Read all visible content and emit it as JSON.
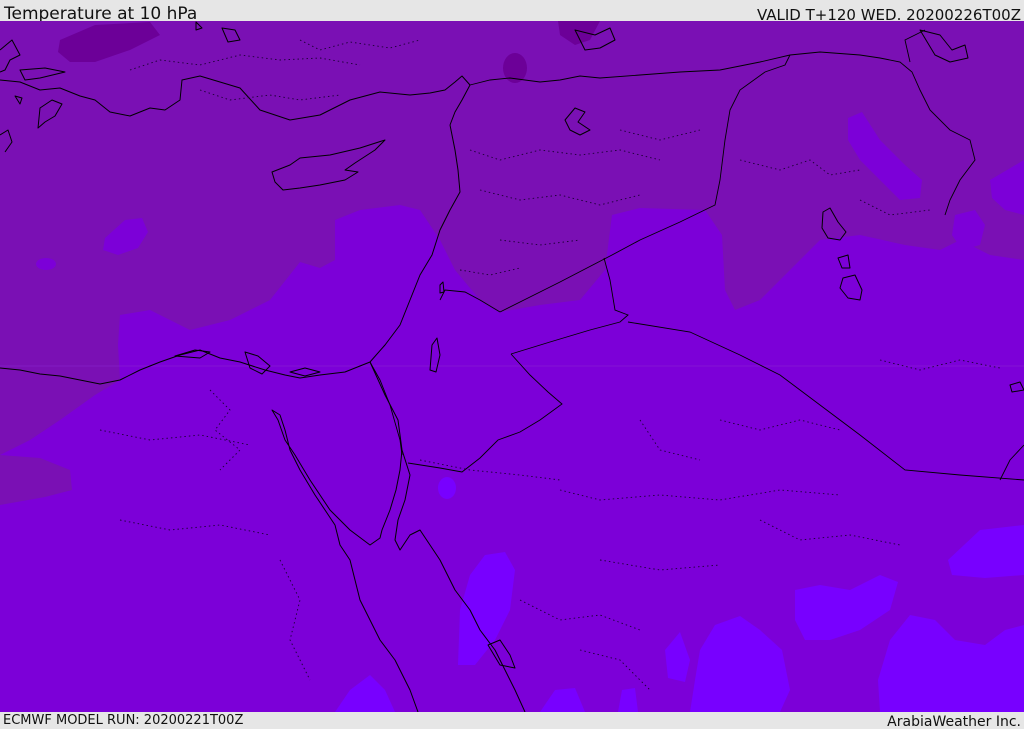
{
  "header": {
    "title": "Temperature at 10 hPa",
    "valid": "VALID T+120 WED. 20200226T00Z"
  },
  "footer": {
    "model_run": "ECMWF MODEL RUN: 20200221T00Z",
    "credit": "ArabiaWeather Inc."
  },
  "colors": {
    "background_band": "#e6e6e6",
    "field_warm": "#7a10b4",
    "field_mid": "#7c00d8",
    "field_cool": "#7800ff",
    "field_darkest": "#6c0098",
    "field_light": "#8420ff",
    "coastline": "#000000",
    "border_dotted": "#1a0033"
  },
  "map": {
    "layers": [
      "temperature-shading",
      "coastlines",
      "country-borders",
      "province-borders"
    ]
  }
}
